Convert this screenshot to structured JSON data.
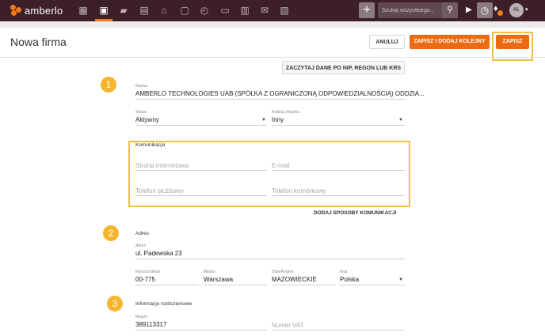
{
  "app": {
    "logo_text": "amberlo"
  },
  "nav": {
    "items": [
      {
        "name": "dashboard",
        "icon": "▦"
      },
      {
        "name": "contacts",
        "icon": "▣"
      },
      {
        "name": "matters",
        "icon": "▰"
      },
      {
        "name": "documents",
        "icon": "▤"
      },
      {
        "name": "bank",
        "icon": "⌂"
      },
      {
        "name": "calendar",
        "icon": "▢"
      },
      {
        "name": "time",
        "icon": "◴"
      },
      {
        "name": "folder",
        "icon": "▭"
      },
      {
        "name": "invoice",
        "icon": "▥"
      },
      {
        "name": "mail",
        "icon": "✉"
      },
      {
        "name": "reports",
        "icon": "▧"
      }
    ]
  },
  "topbar": {
    "plus": "+",
    "search_placeholder": "Szukaj wszystkiego...",
    "play": "▶",
    "timer": "◷",
    "avatar": "AL",
    "caret": "▾"
  },
  "header": {
    "title": "Nowa firma",
    "cancel_label": "ANULUJ",
    "save_next_label": "ZAPISZ I DODAJ KOLEJNY",
    "save_label": "ZAPISZ"
  },
  "form": {
    "fetch_label": "ZACZYTAJ DANE PO NIP, REGON LUB KRS",
    "step1": "1",
    "step2": "2",
    "step3": "3",
    "name": {
      "label": "Nazwa",
      "value": "AMBERLO TECHNOLOGIES UAB (SPÓŁKA Z OGRANICZONĄ ODPOWIEDZIALNOŚCIĄ) ODDZIA..."
    },
    "status": {
      "label": "Status",
      "value": "Aktywny"
    },
    "relation": {
      "label": "Rodzaj związku",
      "value": "Inny"
    },
    "communication": {
      "title": "Komunikacja",
      "website_placeholder": "Strona internetowa",
      "email_placeholder": "E-mail",
      "work_phone_placeholder": "Telefon służbowy",
      "mobile_phone_placeholder": "Telefon komórkowy"
    },
    "add_comm_label": "DODAJ SPOSOBY KOMUNIKACJI",
    "address_section": {
      "title": "Adres",
      "address": {
        "label": "Adres",
        "value": "ul. Padewska 23"
      },
      "postal": {
        "label": "Kod pocztowy",
        "value": "00-775"
      },
      "city": {
        "label": "Miasto",
        "value": "Warszawa"
      },
      "state": {
        "label": "Stan/Region",
        "value": "MAZOWIECKIE"
      },
      "country": {
        "label": "Kraj",
        "value": "Polska"
      }
    },
    "billing_section": {
      "title": "Informacje rozliczeniowe",
      "regon": {
        "label": "Regon",
        "value": "389113317"
      },
      "vat_placeholder": "Numer VAT"
    }
  },
  "colors": {
    "topbar": "#3d1f27",
    "accent": "#ec6a11",
    "highlight": "#f0c04a",
    "step_circle": "#f5b52f"
  }
}
